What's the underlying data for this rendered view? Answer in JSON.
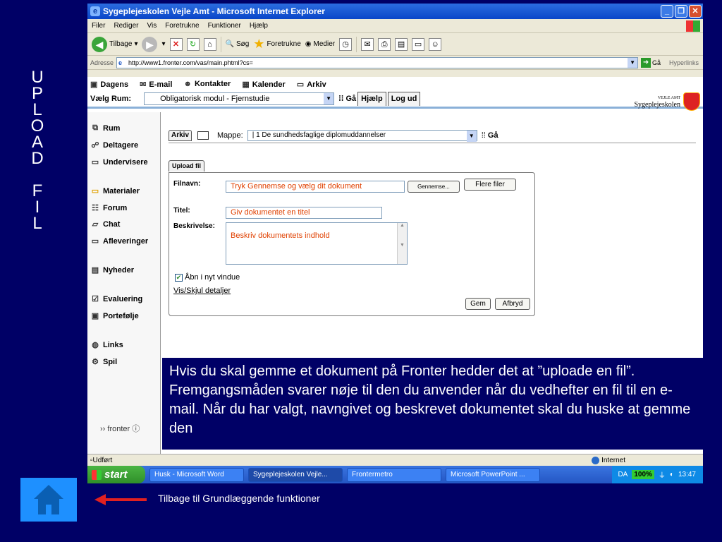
{
  "slide": {
    "vertical_title": [
      "U",
      "P",
      "L",
      "O",
      "A",
      "D",
      "",
      "F",
      "I",
      "L"
    ],
    "back_text": "Tilbage til Grundlæggende funktioner"
  },
  "window": {
    "title": "Sygeplejeskolen Vejle Amt - Microsoft Internet Explorer"
  },
  "menu": [
    "Filer",
    "Rediger",
    "Vis",
    "Foretrukne",
    "Funktioner",
    "Hjælp"
  ],
  "toolbar": {
    "back": "Tilbage",
    "search": "Søg",
    "favorites": "Foretrukne",
    "media": "Medier"
  },
  "address": {
    "label": "Adresse",
    "url": "http://www1.fronter.com/vas/main.phtml?cs=",
    "go": "Gå",
    "links": "Hyperlinks"
  },
  "fronter_nav": [
    "Dagens",
    "E-mail",
    "Kontakter",
    "Kalender",
    "Arkiv"
  ],
  "room": {
    "label": "Vælg Rum:",
    "selected": "Obligatorisk modul - Fjernstudie",
    "go": "Gå",
    "help": "Hjælp",
    "logout": "Log ud",
    "logo_small": "VEJLE AMT",
    "logo_big": "Sygeplejeskolen"
  },
  "sidebar": {
    "items": [
      "Rum",
      "Deltagere",
      "Undervisere",
      "Materialer",
      "Forum",
      "Chat",
      "Afleveringer",
      "Nyheder",
      "Evaluering",
      "Portefølje",
      "Links",
      "Spil"
    ],
    "logo": "fronter"
  },
  "archive": {
    "tab": "Arkiv",
    "folder_label": "Mappe:",
    "folder_selected": "| 1 De sundhedsfaglige diplomuddannelser",
    "go": "Gå"
  },
  "upload": {
    "tab": "Upload fil",
    "filename_label": "Filnavn:",
    "filename_value": "Tryk Gennemse og vælg dit dokument",
    "browse": "Gennemse...",
    "more_files": "Flere filer",
    "title_label": "Titel:",
    "title_value": "Giv dokumentet en titel",
    "desc_label": "Beskrivelse:",
    "desc_value": "Beskriv dokumentets indhold",
    "open_new": "Åbn i nyt vindue",
    "toggle_details": "Vis/Skjul detaljer",
    "save": "Gem",
    "cancel": "Afbryd"
  },
  "info_text": "Hvis du skal gemme et dokument på Fronter hedder det at ”uploade en fil”. Fremgangsmåden svarer nøje til den du anvender når du vedhefter en fil til en e-mail. Når du har valgt, navngivet og beskrevet dokumentet skal du huske at gemme den",
  "statusbar": {
    "status": "Udført",
    "zone": "Internet"
  },
  "taskbar": {
    "start": "start",
    "tasks": [
      "Husk - Microsoft Word",
      "Sygeplejeskolen Vejle...",
      "Frontermetro",
      "Microsoft PowerPoint ..."
    ],
    "lang": "DA",
    "zoom": "100%",
    "clock": "13:47"
  }
}
